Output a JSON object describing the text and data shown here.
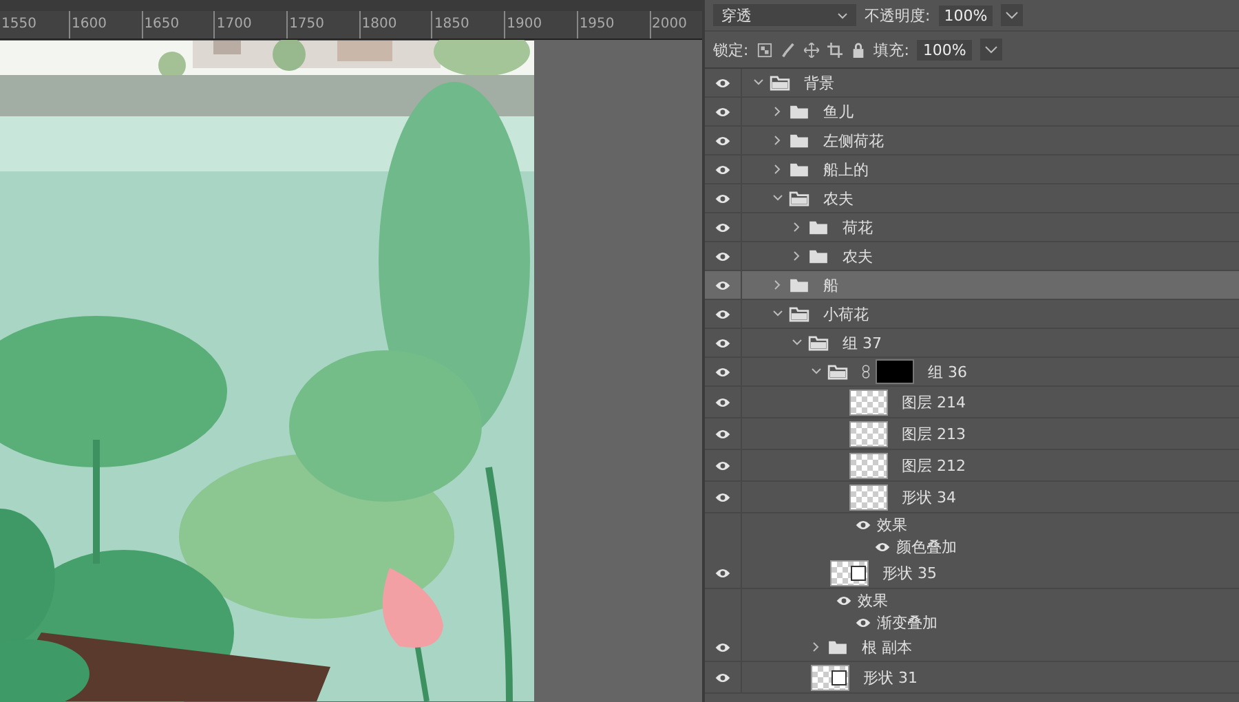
{
  "ruler": {
    "labels": [
      "1550",
      "1600",
      "1650",
      "1700",
      "1750",
      "1800",
      "1850",
      "1900",
      "1950",
      "2000"
    ]
  },
  "layers_panel": {
    "blend_mode": "穿透",
    "opacity_label": "不透明度:",
    "opacity": "100%",
    "lock_label": "锁定:",
    "fill_label": "填充:",
    "fill": "100%",
    "layers": [
      {
        "name": "背景",
        "kind": "folder",
        "visible": true,
        "expanded": true,
        "selected": false,
        "children": [
          {
            "name": "鱼儿",
            "kind": "folder",
            "visible": true,
            "expanded": false,
            "selected": false
          },
          {
            "name": "左侧荷花",
            "kind": "folder",
            "visible": true,
            "expanded": false,
            "selected": false
          },
          {
            "name": "船上的",
            "kind": "folder",
            "visible": true,
            "expanded": false,
            "selected": false
          },
          {
            "name": "农夫",
            "kind": "folder",
            "visible": true,
            "expanded": true,
            "selected": false,
            "children": [
              {
                "name": "荷花",
                "kind": "folder",
                "visible": true,
                "expanded": false,
                "selected": false
              },
              {
                "name": "农夫",
                "kind": "folder",
                "visible": true,
                "expanded": false,
                "selected": false
              }
            ]
          },
          {
            "name": "船",
            "kind": "folder",
            "visible": true,
            "expanded": false,
            "selected": true
          },
          {
            "name": "小荷花",
            "kind": "folder",
            "visible": true,
            "expanded": true,
            "selected": false,
            "children": [
              {
                "name": "组 37",
                "kind": "folder",
                "visible": true,
                "expanded": true,
                "selected": false,
                "children": [
                  {
                    "name": "组 36",
                    "kind": "masked-folder",
                    "visible": true,
                    "expanded": true,
                    "selected": false,
                    "children": [
                      {
                        "name": "图层 214",
                        "kind": "layer",
                        "visible": true,
                        "selected": false
                      },
                      {
                        "name": "图层 213",
                        "kind": "layer",
                        "visible": true,
                        "selected": false
                      },
                      {
                        "name": "图层 212",
                        "kind": "layer",
                        "visible": true,
                        "selected": false
                      },
                      {
                        "name": "形状 34",
                        "kind": "layer",
                        "visible": true,
                        "selected": false,
                        "effects": [
                          {
                            "name": "效果",
                            "visible": true
                          },
                          {
                            "name": "颜色叠加",
                            "visible": true
                          }
                        ]
                      }
                    ]
                  },
                  {
                    "name": "形状 35",
                    "kind": "shape",
                    "visible": true,
                    "selected": false,
                    "effects": [
                      {
                        "name": "效果",
                        "visible": true
                      },
                      {
                        "name": "渐变叠加",
                        "visible": true
                      }
                    ]
                  },
                  {
                    "name": "根 副本",
                    "kind": "folder",
                    "visible": true,
                    "expanded": false,
                    "selected": false
                  }
                ]
              },
              {
                "name": "形状 31",
                "kind": "shape",
                "visible": true,
                "selected": false
              }
            ]
          }
        ]
      }
    ]
  }
}
